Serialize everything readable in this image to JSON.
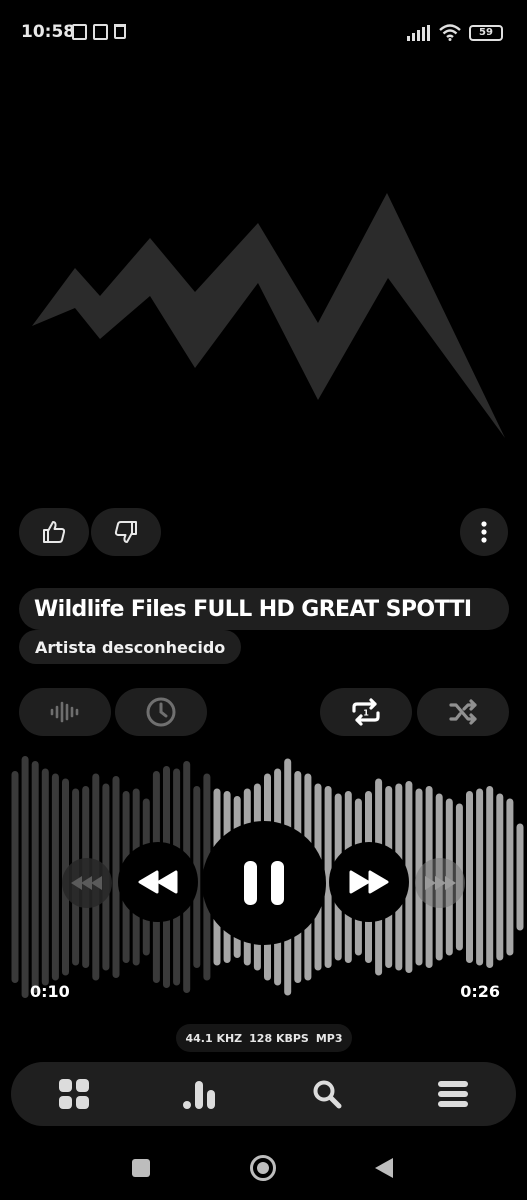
{
  "status_bar": {
    "time": "10:58",
    "battery": "59"
  },
  "track": {
    "title": "Wildlife Files FULL HD GREAT SPOTTI",
    "artist": "Artista desconhecido"
  },
  "playback": {
    "elapsed": "0:10",
    "total": "0:26",
    "progress": 0.38
  },
  "audio_info": {
    "sample_rate": "44.1 KHZ",
    "bitrate": "128 KBPS",
    "format": "MP3"
  },
  "icons": {
    "like": "thumbs-up-icon",
    "dislike": "thumbs-down-icon",
    "menu": "more-vertical-icon",
    "equalizer": "waveform-icon",
    "sleep_timer": "clock-icon",
    "repeat": "repeat-one-icon",
    "shuffle": "shuffle-icon",
    "prev_track": "skip-previous-icon",
    "rewind": "rewind-icon",
    "pause": "pause-icon",
    "fast_forward": "fast-forward-icon",
    "next_track": "skip-next-icon",
    "nav_library": "grid-icon",
    "nav_stats": "bar-chart-icon",
    "nav_search": "search-icon",
    "nav_queue": "menu-icon"
  },
  "colors": {
    "background": "#000000",
    "pill": "#1f1f1f",
    "played_wave": "#3a3a3a",
    "unplayed_wave": "#a6a6a6",
    "artwork": "#2b2b2b"
  }
}
